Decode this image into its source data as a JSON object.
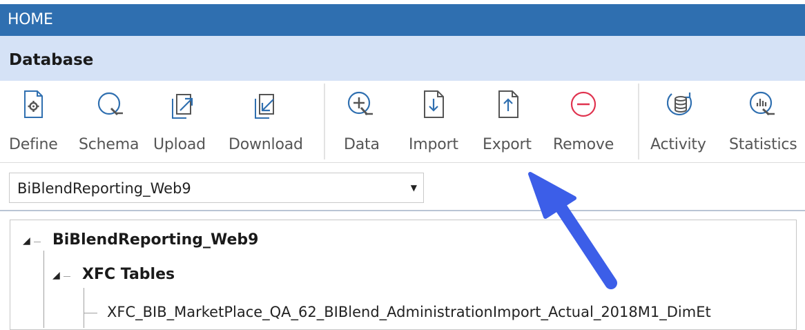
{
  "header": {
    "title": "HOME"
  },
  "subheader": {
    "title": "Database"
  },
  "ribbon": {
    "buttons": [
      {
        "label": "Define",
        "icon": "gear-icon"
      },
      {
        "label": "Schema",
        "icon": "search-icon"
      },
      {
        "label": "Upload",
        "icon": "upload-icon"
      },
      {
        "label": "Download",
        "icon": "download-icon"
      },
      {
        "label": "Data",
        "icon": "zoom-in-icon"
      },
      {
        "label": "Import",
        "icon": "import-icon"
      },
      {
        "label": "Export",
        "icon": "export-icon"
      },
      {
        "label": "Remove",
        "icon": "remove-icon"
      },
      {
        "label": "Activity",
        "icon": "database-activity-icon"
      },
      {
        "label": "Statistics",
        "icon": "statistics-icon"
      }
    ],
    "accent_color": "#2f6fb0",
    "remove_color": "#e0334f"
  },
  "database_select": {
    "value": "BiBlendReporting_Web9"
  },
  "tree": {
    "root": {
      "label": "BiBlendReporting_Web9"
    },
    "group": {
      "label": "XFC Tables"
    },
    "items": [
      {
        "label": "XFC_BIB_MarketPlace_QA_62_BIBlend_AdministrationImport_Actual_2018M1_DimEt"
      }
    ]
  },
  "annotation": {
    "arrow_color": "#3c5ee8",
    "points_to": "Export"
  }
}
